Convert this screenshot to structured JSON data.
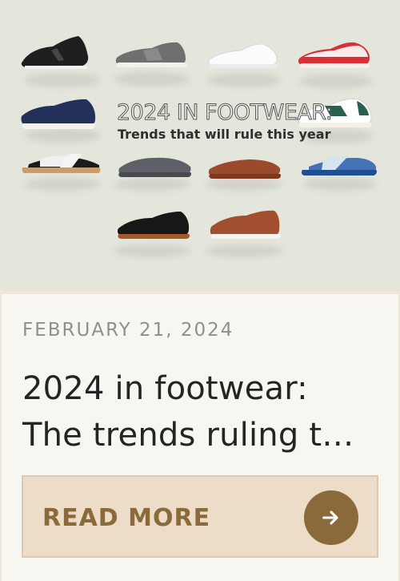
{
  "hero": {
    "headline": "2024 IN FOOTWEAR:",
    "subheadline": "Trends that will rule this year",
    "background": "#e4e6dc"
  },
  "post": {
    "date": "FEBRUARY 21, 2024",
    "title_line_1": "2024 in footwear:",
    "title_line_2": "The trends ruling t…",
    "read_more": "READ MORE",
    "arrow_icon": "arrow-right-icon"
  },
  "colors": {
    "button_bg": "#eddcc7",
    "button_border": "#dec8af",
    "accent": "#8a6a3b",
    "text": "#242424",
    "muted": "#8f8f8f"
  }
}
